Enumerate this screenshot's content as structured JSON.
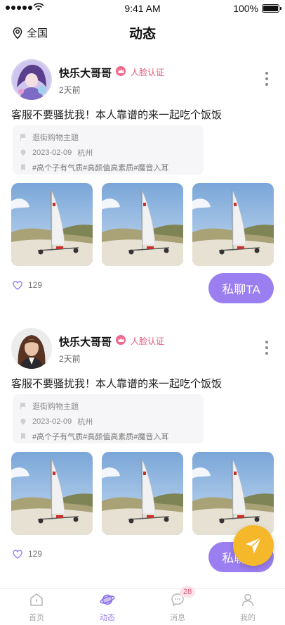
{
  "status_bar": {
    "time": "9:41 AM",
    "battery": "100%"
  },
  "header": {
    "location": "全国",
    "title": "动态"
  },
  "posts": [
    {
      "username": "快乐大哥哥",
      "verify_label": "人脸认证",
      "time": "2天前",
      "content": "客服不要骚扰我！本人靠谱的来一起吃个饭饭",
      "topic": "逛街购物主题",
      "date": "2023-02-09",
      "city": "杭州",
      "tags": [
        "#高个子有气质",
        "#高颜值高素质",
        "#魔音入耳"
      ],
      "likes": "129",
      "chat_label": "私聊TA"
    },
    {
      "username": "快乐大哥哥",
      "verify_label": "人脸认证",
      "time": "2天前",
      "content": "客服不要骚扰我！本人靠谱的来一起吃个饭饭",
      "topic": "逛街购物主题",
      "date": "2023-02-09",
      "city": "杭州",
      "tags": [
        "#高个子有气质",
        "#高颜值高素质",
        "#魔音入耳"
      ],
      "likes": "129",
      "chat_label": "私聊TA"
    }
  ],
  "tabbar": {
    "items": [
      {
        "label": "首页",
        "icon": "home-icon"
      },
      {
        "label": "动态",
        "icon": "planet-icon",
        "active": true
      },
      {
        "label": "消息",
        "icon": "message-icon",
        "badge": "28"
      },
      {
        "label": "我的",
        "icon": "user-icon"
      }
    ]
  },
  "colors": {
    "accent": "#9b7ef0",
    "verify": "#e05a7c",
    "fab": "#f6b82b"
  },
  "fab": {
    "icon": "send-icon"
  }
}
